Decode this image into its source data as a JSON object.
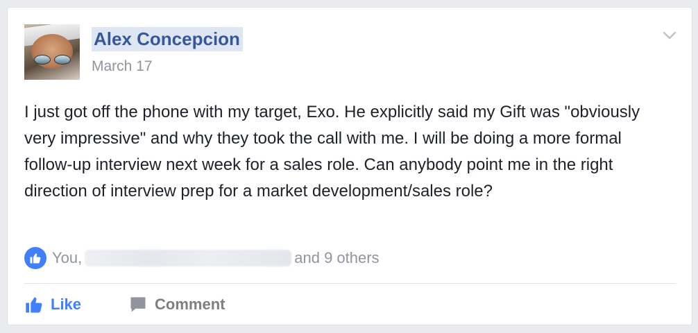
{
  "post": {
    "author": "Alex Concepcion",
    "date": "March 17",
    "body": "I just got off the phone with my target, Exo. He explicitly said my Gift was \"obviously very impressive\" and why they took the call with me. I will be doing a more formal follow-up interview next week for a sales role. Can anybody point me in the right direction of interview prep for a market development/sales role?"
  },
  "reactions": {
    "you_label": "You,",
    "others_label": "and 9 others",
    "icon": "thumbs-up-icon"
  },
  "actions": {
    "like_label": "Like",
    "comment_label": "Comment",
    "like_icon": "thumbs-up-icon",
    "comment_icon": "speech-bubble-icon"
  },
  "colors": {
    "accent": "#4080ff",
    "name_link": "#365899",
    "muted": "#90949c"
  }
}
